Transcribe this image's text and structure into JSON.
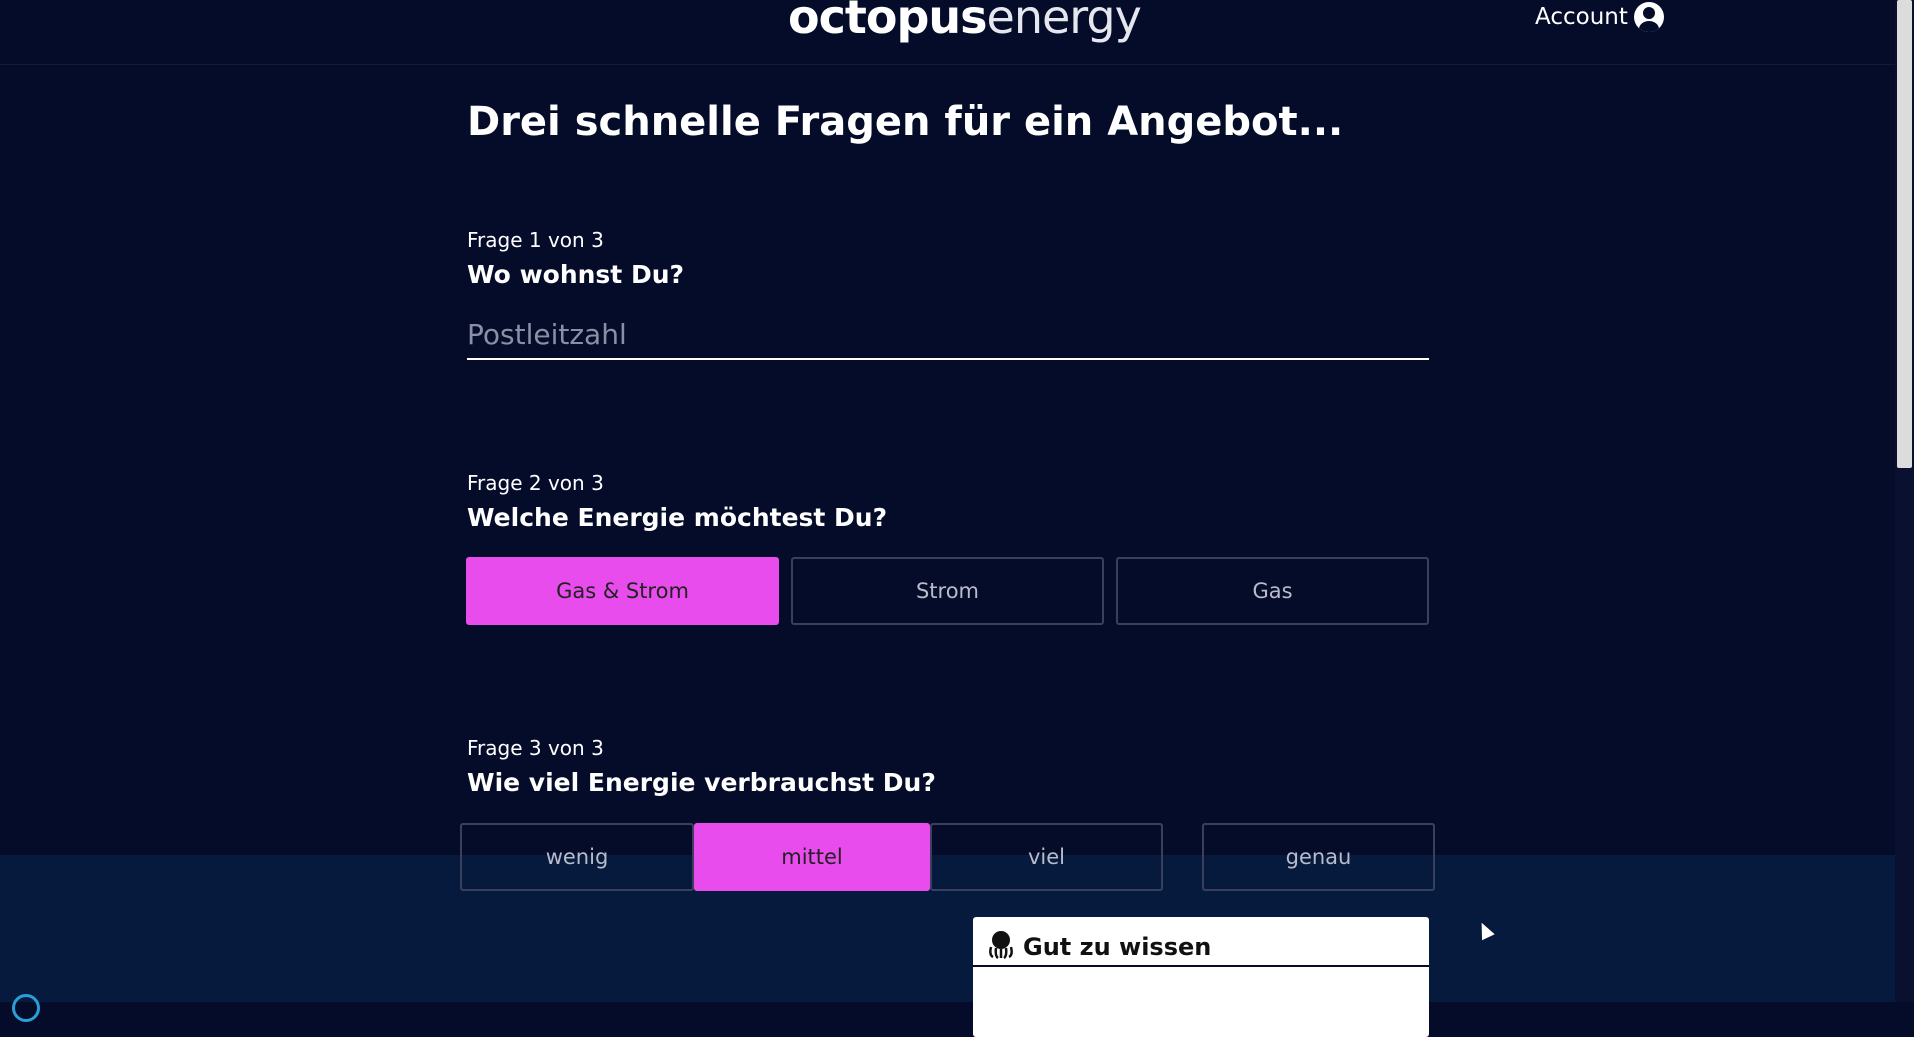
{
  "header": {
    "logo_bold": "octopus",
    "logo_light": "energy",
    "account_label": "Account"
  },
  "page": {
    "title": "Drei schnelle Fragen für ein Angebot..."
  },
  "question1": {
    "step": "Frage 1 von 3",
    "text": "Wo wohnst Du?",
    "postcode_placeholder": "Postleitzahl",
    "postcode_value": ""
  },
  "question2": {
    "step": "Frage 2 von 3",
    "text": "Welche Energie möchtest Du?",
    "options": [
      "Gas & Strom",
      "Strom",
      "Gas"
    ],
    "selected": "Gas & Strom"
  },
  "question3": {
    "step": "Frage 3 von 3",
    "text": "Wie viel Energie verbrauchst Du?",
    "options": [
      "wenig",
      "mittel",
      "viel",
      "genau"
    ],
    "selected": "mittel"
  },
  "info_card": {
    "title": "Gut zu wissen"
  },
  "colors": {
    "background": "#050c2a",
    "accent": "#e94cec",
    "lower_band": "#061a3e"
  }
}
